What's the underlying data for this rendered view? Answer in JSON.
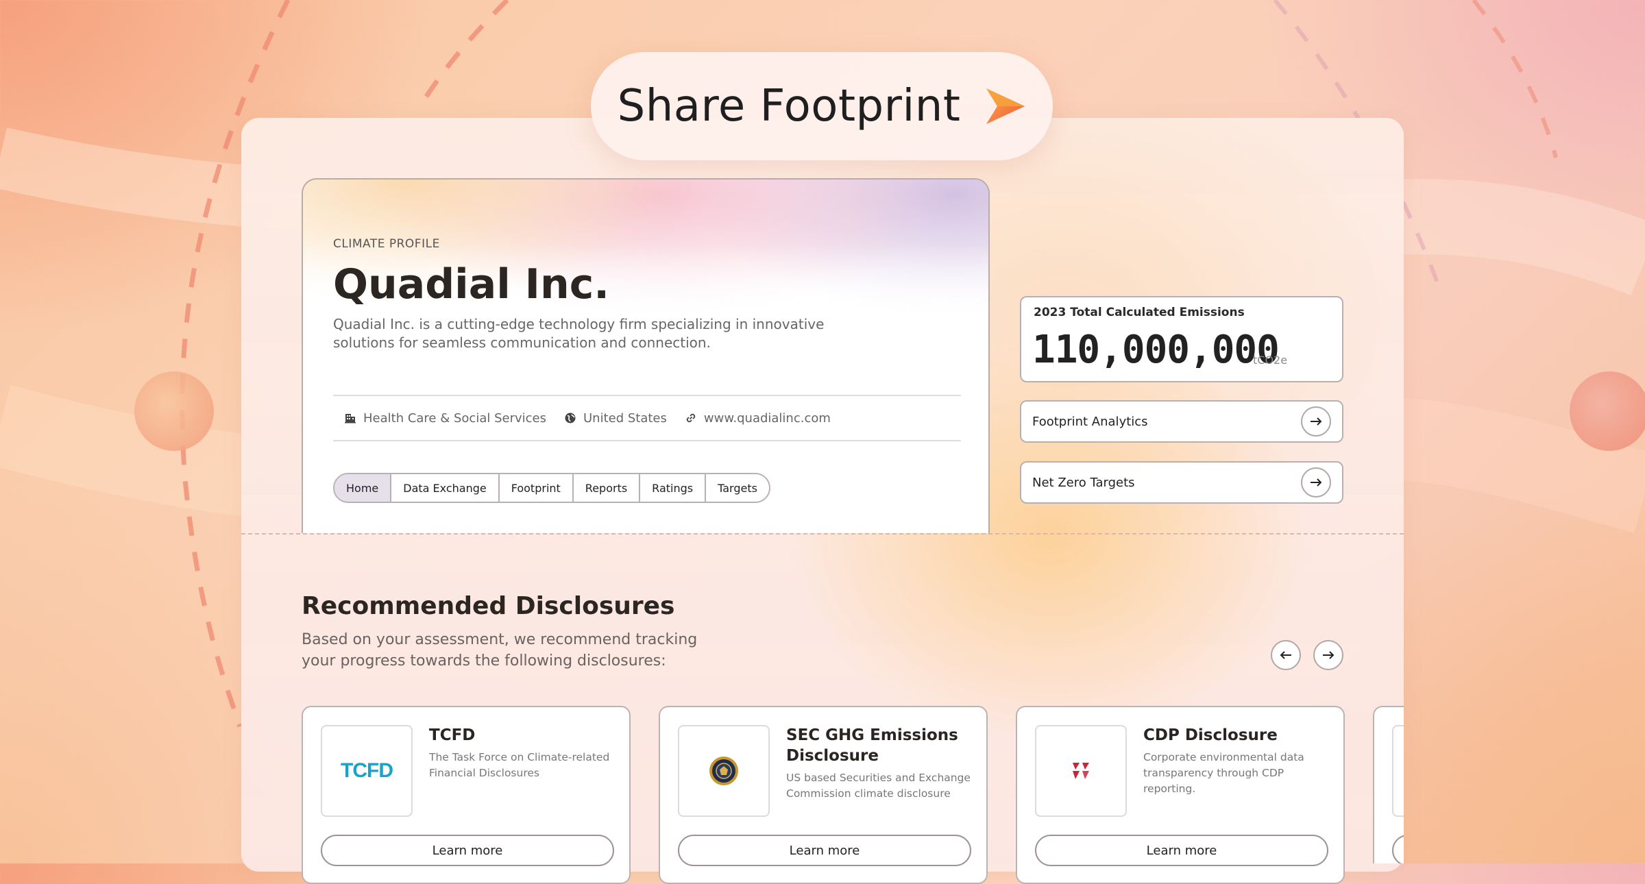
{
  "share": {
    "title": "Share Footprint"
  },
  "profile": {
    "eyebrow": "CLIMATE PROFILE",
    "company": "Quadial Inc.",
    "description": "Quadial Inc. is a cutting-edge technology firm specializing in innovative solutions for seamless communication and connection.",
    "industry": "Health Care & Social Services",
    "country": "United States",
    "website": "www.quadialinc.com",
    "tabs": [
      "Home",
      "Data Exchange",
      "Footprint",
      "Reports",
      "Ratings",
      "Targets"
    ],
    "active_tab": "Home"
  },
  "emissions": {
    "label": "2023 Total Calculated Emissions",
    "value": "110,000,000",
    "unit": "tCO2e"
  },
  "links": {
    "analytics": "Footprint Analytics",
    "targets": "Net Zero Targets"
  },
  "recommended": {
    "title": "Recommended Disclosures",
    "description": "Based on your assessment, we recommend tracking your progress towards the following disclosures:"
  },
  "disclosures": [
    {
      "title": "TCFD",
      "description": "The Task Force on Climate-related Financial Disclosures",
      "logo": "TCFD",
      "button": "Learn more"
    },
    {
      "title": "SEC GHG Emissions Disclosure",
      "description": "US based Securities and Exchange Commission climate disclosure",
      "logo": "sec-seal",
      "button": "Learn more"
    },
    {
      "title": "CDP Disclosure",
      "description": "Corporate environmental data transparency through CDP reporting.",
      "logo": "cdp-mark",
      "button": "Learn more"
    }
  ],
  "colors": {
    "accent": "#f36b3b",
    "tcfd": "#1aa3c7",
    "cdp": "#c8243a"
  }
}
